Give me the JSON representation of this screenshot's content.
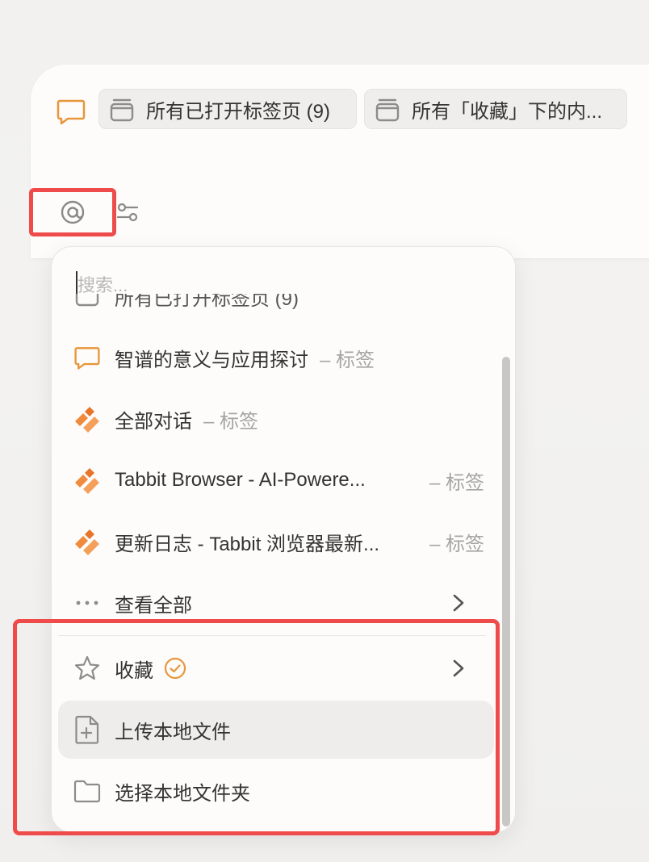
{
  "composer": {
    "chips": [
      {
        "label": "所有已打开标签页 (9)",
        "icon": "tabs-stack-icon"
      },
      {
        "label": "所有「收藏」下的内...",
        "icon": "tabs-stack-icon"
      }
    ],
    "mention_icon": "at-sign-icon",
    "settings_icon": "sliders-icon"
  },
  "dropdown": {
    "search_placeholder": "搜索...",
    "cut_item": "所有已打开标签页 (9)",
    "items": [
      {
        "title": "智谱的意义与应用探讨",
        "tag": "– 标签",
        "icon": "chat-bubble-icon"
      },
      {
        "title": "全部对话",
        "tag": "– 标签",
        "icon": "tabbit-logo-icon"
      },
      {
        "title": "Tabbit Browser - AI-Powere...",
        "tag": "– 标签",
        "icon": "tabbit-logo-icon"
      },
      {
        "title": "更新日志 - Tabbit 浏览器最新...",
        "tag": "– 标签",
        "icon": "tabbit-logo-icon"
      }
    ],
    "view_all": "查看全部",
    "favorites": "收藏",
    "upload_file": "上传本地文件",
    "choose_folder": "选择本地文件夹"
  },
  "colors": {
    "accent_orange": "#e8963a",
    "highlight_red": "#ef4b4b"
  }
}
